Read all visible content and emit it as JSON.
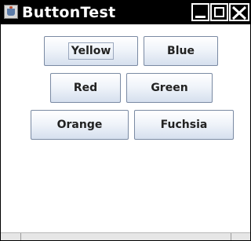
{
  "window": {
    "title": "ButtonTest",
    "icon": "java-coffee-icon",
    "controls": [
      "minimize-icon",
      "maximize-icon",
      "close-icon"
    ]
  },
  "buttons": {
    "yellow": "Yellow",
    "blue": "Blue",
    "red": "Red",
    "green": "Green",
    "orange": "Orange",
    "fuchsia": "Fuchsia"
  },
  "focused_button": "Yellow",
  "colors": {
    "titlebar": "#000000",
    "title_text": "#ffffff",
    "button_border": "#7a8aa3",
    "button_gradient_top": "#ffffff",
    "button_gradient_bottom": "#d6e0ee"
  }
}
